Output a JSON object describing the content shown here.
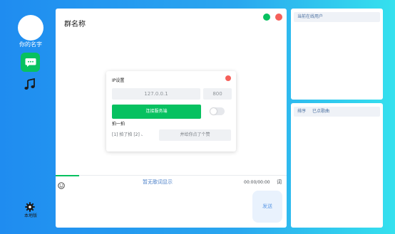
{
  "sidebar": {
    "user_name": "你的名字",
    "local_label": "本地版",
    "icons": {
      "chat": "chat-bubble-icon",
      "music": "music-note-icon",
      "settings": "gear-icon"
    }
  },
  "chat": {
    "group_name": "群名称",
    "lyric_status": "暂无歌词显示",
    "time": "00:00/00:00",
    "lyric_button": "词",
    "send_button": "发送"
  },
  "ip_dialog": {
    "title": "IP设置",
    "ip_value": "127.0.0.1",
    "port_value": "800",
    "connect_button": "连接服务端",
    "pat_title": "拍一拍",
    "pat_text": "[1] 拍了拍 [2] 、",
    "pat_button": "并给你点了个赞"
  },
  "online_users": {
    "header": "当前在线用户"
  },
  "song_list": {
    "col_order": "排序",
    "col_songs": "已点歌曲"
  },
  "colors": {
    "accent_green": "#07c160",
    "close_red": "#f5605a",
    "link_blue": "#4a7fc8"
  }
}
